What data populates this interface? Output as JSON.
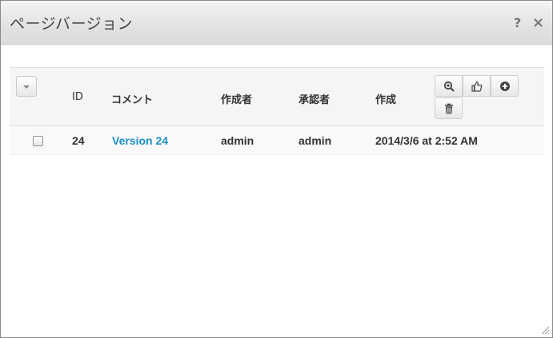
{
  "dialog": {
    "title": "ページバージョン",
    "help_label": "?",
    "close_label": "×"
  },
  "table": {
    "headers": {
      "id": "ID",
      "comment": "コメント",
      "author": "作成者",
      "approver": "承認者",
      "created": "作成"
    },
    "rows": [
      {
        "checked": false,
        "id": "24",
        "comment": "Version 24",
        "author": "admin",
        "approver": "admin",
        "created": "2014/3/6 at 2:52 AM"
      }
    ]
  },
  "toolbar": {
    "icons": [
      "zoom-in-icon",
      "thumbs-up-icon",
      "plus-circle-icon",
      "trash-icon"
    ]
  },
  "colors": {
    "link": "#1b8fc6",
    "titlebar": "#e2e2e2",
    "header_bg": "#f5f5f5"
  }
}
